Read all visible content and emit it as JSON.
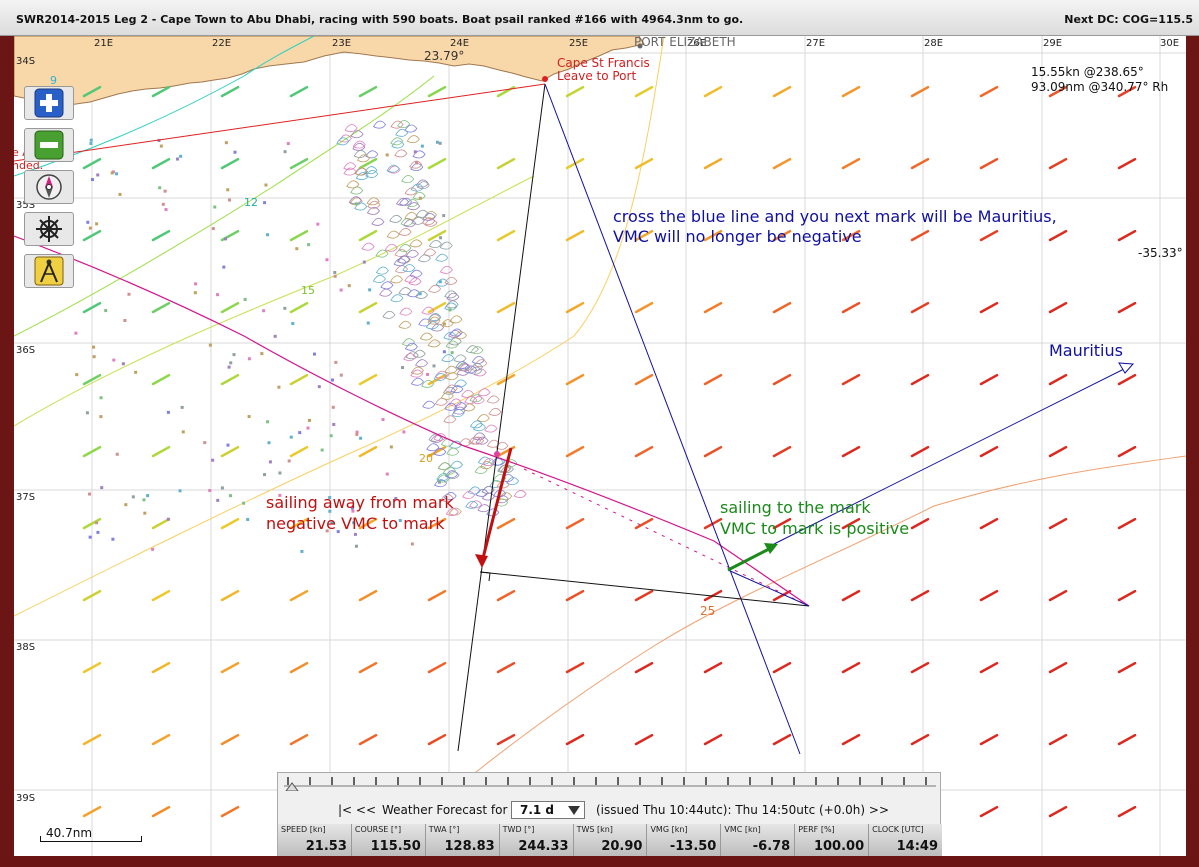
{
  "window": {
    "title": "SWR2014-2015 Leg 2 - Cape Town to Abu Dhabi, racing with 590 boats. Boat psail ranked #166 with 4964.3nm to go.",
    "next_dc": "Next DC: COG=115.5"
  },
  "map": {
    "lon_labels": [
      "21E",
      "22E",
      "23E",
      "24E",
      "25E",
      "26E",
      "27E",
      "28E",
      "29E",
      "30E"
    ],
    "lat_labels": [
      "34S",
      "35S",
      "36S",
      "37S",
      "38S",
      "39S"
    ],
    "places": {
      "port_elizabeth": "PORT ELIZABETH",
      "cape_st_francis": "Cape St Francis",
      "leave_to_port": "Leave to Port",
      "mauritius": "Mauritius",
      "sea_temp": "23.79°"
    },
    "isochrone_labels": [
      "9",
      "12",
      "15",
      "20",
      "25"
    ],
    "partial_left_text": [
      "e Ad s",
      "nded."
    ],
    "readout": {
      "line1": "15.55kn @238.65°",
      "line2": "93.09nm @340.77° Rh"
    },
    "lat_readout": "-35.33°",
    "annotations": {
      "blue": "cross the blue line and you next mark will be Mauritius,\nVMC will no longer be negative",
      "red": "sailing away from mark\nnegative VMC to mark",
      "green": "sailing to the mark\nVMC to mark is positive"
    },
    "scale_label": "40.7nm",
    "colors": {
      "land": "#f8d8a8",
      "boat_track": "#d4148c",
      "course_line": "#e02020",
      "mark_line": "#1010a0",
      "vmc_negative": "#c01010",
      "vmc_positive": "#1a8a1a"
    }
  },
  "tools": [
    {
      "name": "zoom-in-button",
      "icon": "plus-icon"
    },
    {
      "name": "zoom-out-button",
      "icon": "minus-icon"
    },
    {
      "name": "center-boat-button",
      "icon": "compass-icon"
    },
    {
      "name": "helm-button",
      "icon": "ship-wheel-icon"
    },
    {
      "name": "measure-button",
      "icon": "dividers-icon"
    }
  ],
  "weather": {
    "prev_label": "|<  <<",
    "label": "Weather Forecast for",
    "selected": "7.1 d",
    "issued": "(issued Thu 10:44utc): Thu 14:50utc  (+0.0h)  >>"
  },
  "stats": [
    {
      "label": "SPEED [kn]",
      "value": "21.53"
    },
    {
      "label": "COURSE [°]",
      "value": "115.50"
    },
    {
      "label": "TWA [°]",
      "value": "128.83"
    },
    {
      "label": "TWD [°]",
      "value": "244.33"
    },
    {
      "label": "TWS [kn]",
      "value": "20.90"
    },
    {
      "label": "VMG [kn]",
      "value": "-13.50"
    },
    {
      "label": "VMC [kn]",
      "value": "-6.78"
    },
    {
      "label": "PERF [%]",
      "value": "100.00"
    },
    {
      "label": "CLOCK [UTC]",
      "value": "14:49"
    }
  ]
}
